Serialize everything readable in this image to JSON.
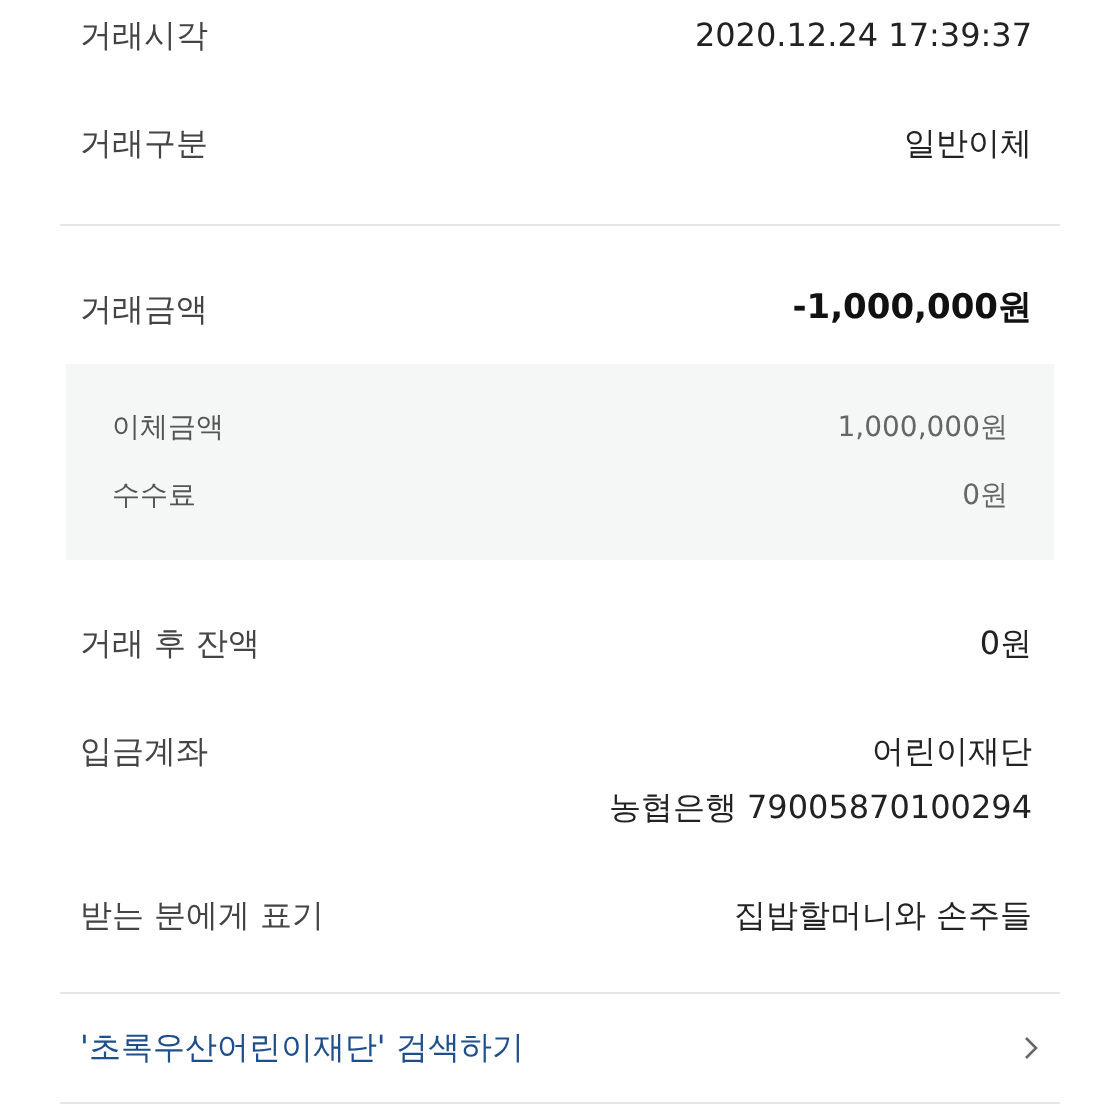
{
  "details": [
    {
      "label": "거래시각",
      "values": [
        "2020.12.24 17:39:37"
      ]
    },
    {
      "label": "거래구분",
      "values": [
        "일반이체"
      ]
    }
  ],
  "amount": {
    "label": "거래금액",
    "value": "-1,000,000원",
    "breakdown": [
      {
        "label": "이체금액",
        "value": "1,000,000원"
      },
      {
        "label": "수수료",
        "value": "0원"
      }
    ]
  },
  "after": [
    {
      "label": "거래 후 잔액",
      "values": [
        "0원"
      ]
    },
    {
      "label": "입금계좌",
      "values": [
        "어린이재단",
        "농협은행 79005870100294"
      ]
    },
    {
      "label": "받는 분에게 표기",
      "values": [
        "집밥할머니와 손주들"
      ]
    }
  ],
  "search_link": {
    "label": "'초록우산어린이재단' 검색하기"
  }
}
